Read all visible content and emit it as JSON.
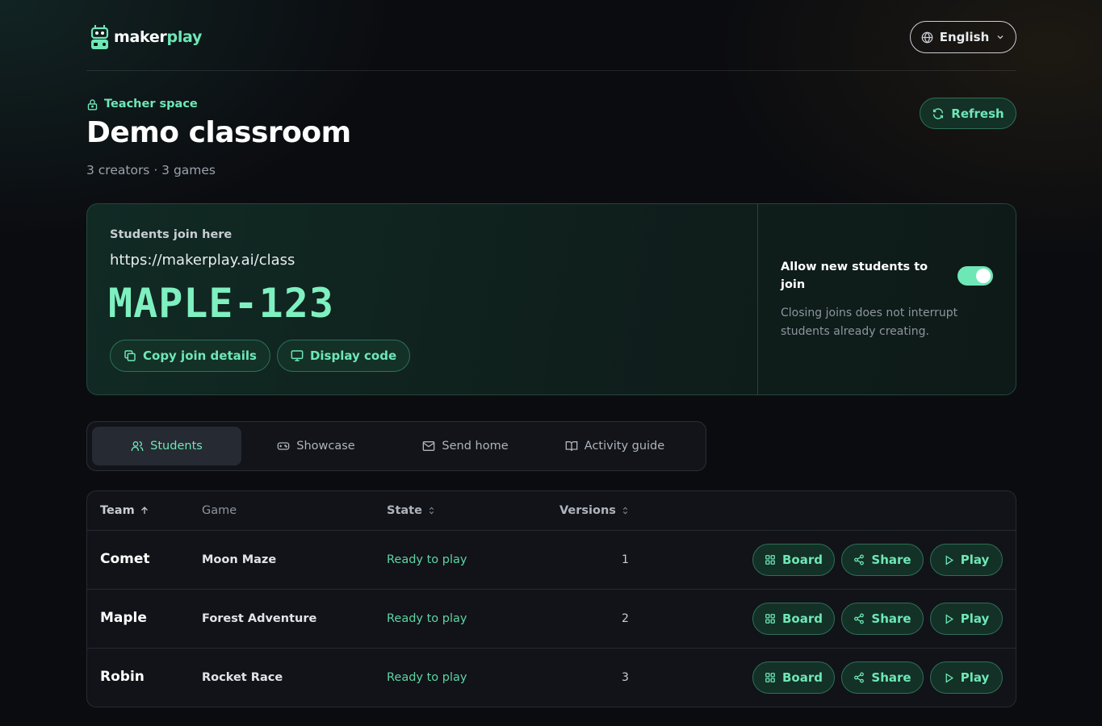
{
  "brand": {
    "name_part1": "maker",
    "name_part2": "play"
  },
  "header": {
    "language_label": "English"
  },
  "classroom": {
    "space_label": "Teacher space",
    "title": "Demo classroom",
    "subtitle": "3 creators · 3 games",
    "refresh_label": "Refresh"
  },
  "join": {
    "label": "Students join here",
    "url": "https://makerplay.ai/class",
    "code": "MAPLE-123",
    "copy_label": "Copy join details",
    "display_label": "Display code",
    "allow_label": "Allow new students to join",
    "allow_enabled": true,
    "allow_help": "Closing joins does not interrupt students already creating."
  },
  "tabs": [
    {
      "label": "Students",
      "icon": "users-icon",
      "active": true
    },
    {
      "label": "Showcase",
      "icon": "gamepad-icon",
      "active": false
    },
    {
      "label": "Send home",
      "icon": "mail-icon",
      "active": false
    },
    {
      "label": "Activity guide",
      "icon": "book-icon",
      "active": false
    }
  ],
  "table": {
    "columns": {
      "team": "Team",
      "game": "Game",
      "state": "State",
      "versions": "Versions"
    },
    "rows": [
      {
        "team": "Comet",
        "game": "Moon Maze",
        "state": "Ready to play",
        "versions": "1"
      },
      {
        "team": "Maple",
        "game": "Forest Adventure",
        "state": "Ready to play",
        "versions": "2"
      },
      {
        "team": "Robin",
        "game": "Rocket Race",
        "state": "Ready to play",
        "versions": "3"
      }
    ],
    "actions": {
      "board": "Board",
      "share": "Share",
      "play": "Play"
    }
  },
  "colors": {
    "accent": "#6ee7b7",
    "background": "#0b0c10",
    "card": "#112a24"
  }
}
